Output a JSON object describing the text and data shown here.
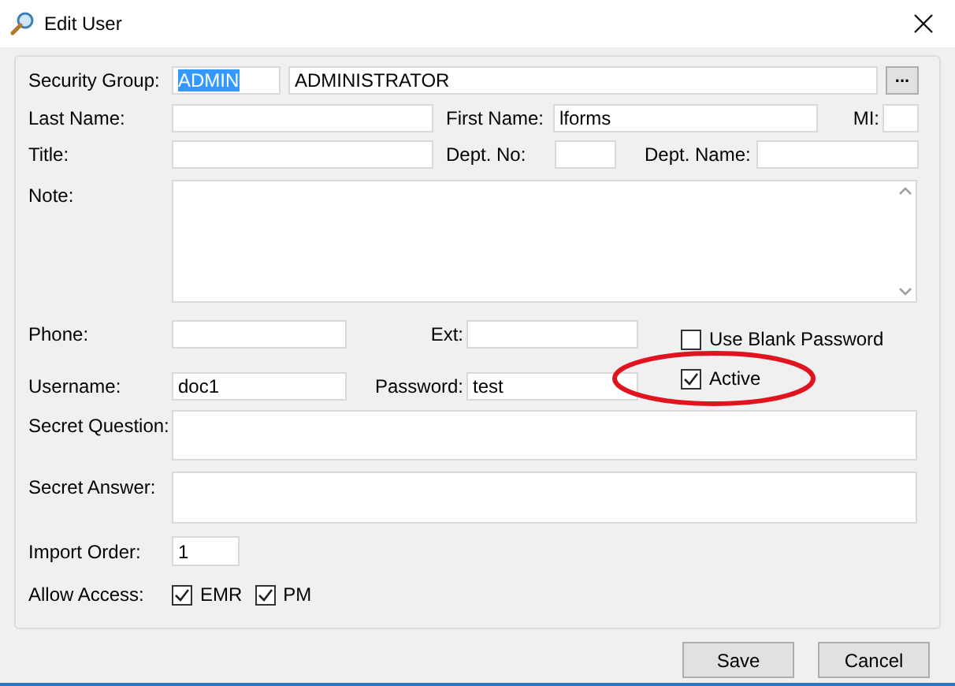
{
  "window": {
    "title": "Edit User"
  },
  "security_group": {
    "label": "Security Group:",
    "code": {
      "value": "ADMIN",
      "text_selected": true
    },
    "name": {
      "value": "ADMINISTRATOR"
    },
    "browse_button": "..."
  },
  "last_name": {
    "label": "Last Name:"
  },
  "first_name": {
    "label": "First Name:",
    "value": "lforms"
  },
  "mi": {
    "label": "MI:"
  },
  "title_field": {
    "label": "Title:"
  },
  "dept_no": {
    "label": "Dept. No:"
  },
  "dept_name": {
    "label": "Dept. Name:"
  },
  "note": {
    "label": "Note:"
  },
  "phone": {
    "label": "Phone:"
  },
  "ext": {
    "label": "Ext:"
  },
  "use_blank_password": {
    "label": "Use Blank Password",
    "checked": false
  },
  "username": {
    "label": "Username:",
    "value": "doc1"
  },
  "password": {
    "label": "Password:",
    "value": "test"
  },
  "active": {
    "label": "Active",
    "checked": true
  },
  "secret_question": {
    "label": "Secret Question:"
  },
  "secret_answer": {
    "label": "Secret Answer:"
  },
  "import_order": {
    "label": "Import Order:",
    "value": "1"
  },
  "allow_access": {
    "label": "Allow Access:",
    "options": [
      {
        "label": "EMR",
        "checked": true
      },
      {
        "label": "PM",
        "checked": true
      }
    ]
  },
  "annotation": {
    "kind": "ellipse"
  },
  "buttons": [
    "Save",
    "Cancel"
  ]
}
